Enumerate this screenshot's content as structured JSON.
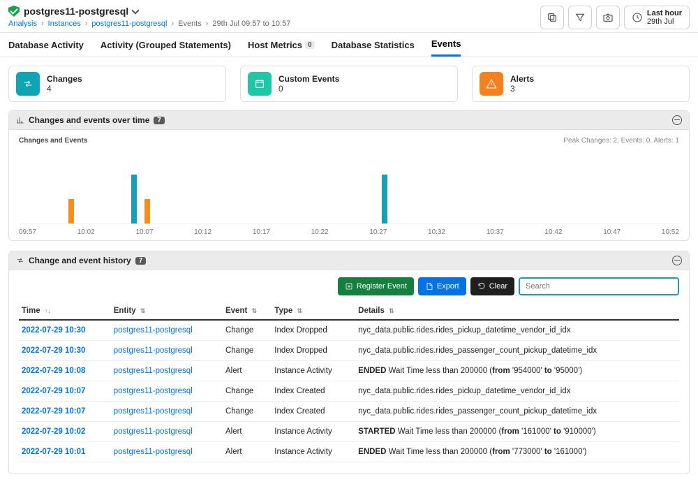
{
  "header": {
    "instance_name": "postgres11-postgresql",
    "breadcrumbs": [
      "Analysis",
      "Instances",
      "postgres11-postgresql",
      "Events",
      "29th Jul 09:57 to 10:57"
    ],
    "time_picker": {
      "line1": "Last hour",
      "line2": "29th Jul"
    }
  },
  "tabs": {
    "items": [
      {
        "label": "Database Activity",
        "active": false
      },
      {
        "label": "Activity (Grouped Statements)",
        "active": false
      },
      {
        "label": "Host Metrics",
        "active": false,
        "badge": "0"
      },
      {
        "label": "Database Statistics",
        "active": false
      },
      {
        "label": "Events",
        "active": true
      }
    ]
  },
  "cards": {
    "changes": {
      "title": "Changes",
      "value": "4"
    },
    "custom": {
      "title": "Custom Events",
      "value": "0"
    },
    "alerts": {
      "title": "Alerts",
      "value": "3"
    }
  },
  "chart_panel": {
    "title": "Changes and events over time",
    "count": "7",
    "subtitle": "Changes and Events",
    "peak_text": "Peak Changes: 2, Events: 0, Alerts: 1"
  },
  "chart_data": {
    "type": "bar",
    "categories": [
      "09:57",
      "10:02",
      "10:07",
      "10:12",
      "10:17",
      "10:22",
      "10:27",
      "10:32",
      "10:37",
      "10:42",
      "10:47",
      "10:52"
    ],
    "series": [
      {
        "name": "Changes",
        "color": "#1a9eb5",
        "values": [
          0,
          0,
          2,
          0,
          0,
          0,
          0,
          2,
          0,
          0,
          0,
          0
        ]
      },
      {
        "name": "Alerts",
        "color": "#ff8c1a",
        "values": [
          0,
          1,
          1,
          0,
          0,
          0,
          0,
          0,
          0,
          0,
          0,
          0
        ]
      }
    ],
    "title": "Changes and Events",
    "xlabel": "",
    "ylabel": "",
    "ylim": [
      0,
      2
    ],
    "note": "Second alert bar sits just after 10:07 (~10:08); second teal bar sits between 10:27 and 10:32 (~10:30)."
  },
  "history_panel": {
    "title": "Change and event history",
    "count": "7",
    "buttons": {
      "register": "Register Event",
      "export": "Export",
      "clear": "Clear"
    },
    "search_placeholder": "Search",
    "columns": [
      "Time",
      "Entity",
      "Event",
      "Type",
      "Details"
    ],
    "rows": [
      {
        "time": "2022-07-29 10:30",
        "entity": "postgres11-postgresql",
        "event": "Change",
        "type": "Index Dropped",
        "details_html": "nyc_data.public.rides.rides_pickup_datetime_vendor_id_idx"
      },
      {
        "time": "2022-07-29 10:30",
        "entity": "postgres11-postgresql",
        "event": "Change",
        "type": "Index Dropped",
        "details_html": "nyc_data.public.rides.rides_passenger_count_pickup_datetime_idx"
      },
      {
        "time": "2022-07-29 10:08",
        "entity": "postgres11-postgresql",
        "event": "Alert",
        "type": "Instance Activity",
        "details_html": "<b>ENDED</b> Wait Time less than 200000 (<b>from</b> '954000' <b>to</b> '95000')"
      },
      {
        "time": "2022-07-29 10:07",
        "entity": "postgres11-postgresql",
        "event": "Change",
        "type": "Index Created",
        "details_html": "nyc_data.public.rides.rides_pickup_datetime_vendor_id_idx"
      },
      {
        "time": "2022-07-29 10:07",
        "entity": "postgres11-postgresql",
        "event": "Change",
        "type": "Index Created",
        "details_html": "nyc_data.public.rides.rides_passenger_count_pickup_datetime_idx"
      },
      {
        "time": "2022-07-29 10:02",
        "entity": "postgres11-postgresql",
        "event": "Alert",
        "type": "Instance Activity",
        "details_html": "<b>STARTED</b> Wait Time less than 200000 (<b>from</b> '161000' <b>to</b> '910000')"
      },
      {
        "time": "2022-07-29 10:01",
        "entity": "postgres11-postgresql",
        "event": "Alert",
        "type": "Instance Activity",
        "details_html": "<b>ENDED</b> Wait Time less than 200000 (<b>from</b> '773000' <b>to</b> '161000')"
      }
    ]
  }
}
